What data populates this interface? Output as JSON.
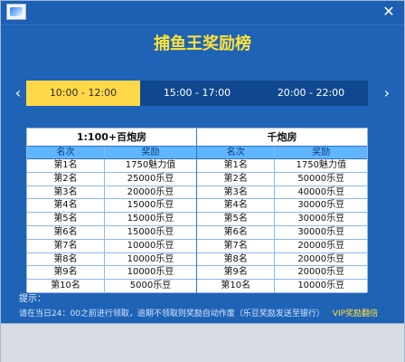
{
  "window": {
    "close_glyph": "✕"
  },
  "header": {
    "title": "捕鱼王奖励榜"
  },
  "nav": {
    "prev_glyph": "‹",
    "next_glyph": "›"
  },
  "tabs": [
    {
      "label": "10:00 - 12:00",
      "active": true
    },
    {
      "label": "15:00 - 17:00",
      "active": false
    },
    {
      "label": "20:00 - 22:00",
      "active": false
    }
  ],
  "tables": [
    {
      "title": "1:100+百炮房",
      "columns": [
        "名次",
        "奖励"
      ],
      "rows": [
        [
          "第1名",
          "1750魅力值"
        ],
        [
          "第2名",
          "25000乐豆"
        ],
        [
          "第3名",
          "20000乐豆"
        ],
        [
          "第4名",
          "15000乐豆"
        ],
        [
          "第5名",
          "15000乐豆"
        ],
        [
          "第6名",
          "15000乐豆"
        ],
        [
          "第7名",
          "10000乐豆"
        ],
        [
          "第8名",
          "10000乐豆"
        ],
        [
          "第9名",
          "10000乐豆"
        ],
        [
          "第10名",
          "5000乐豆"
        ]
      ]
    },
    {
      "title": "千炮房",
      "columns": [
        "名次",
        "奖励"
      ],
      "rows": [
        [
          "第1名",
          "1750魅力值"
        ],
        [
          "第2名",
          "50000乐豆"
        ],
        [
          "第3名",
          "40000乐豆"
        ],
        [
          "第4名",
          "30000乐豆"
        ],
        [
          "第5名",
          "30000乐豆"
        ],
        [
          "第6名",
          "30000乐豆"
        ],
        [
          "第7名",
          "20000乐豆"
        ],
        [
          "第8名",
          "20000乐豆"
        ],
        [
          "第9名",
          "20000乐豆"
        ],
        [
          "第10名",
          "10000乐豆"
        ]
      ]
    }
  ],
  "footer": {
    "label": "提示：",
    "text": "请在当日24：00之前进行领取，逾期不领取则奖励自动作废（乐豆奖励发送至银行）",
    "vip_text": "VIP奖励翻倍"
  }
}
